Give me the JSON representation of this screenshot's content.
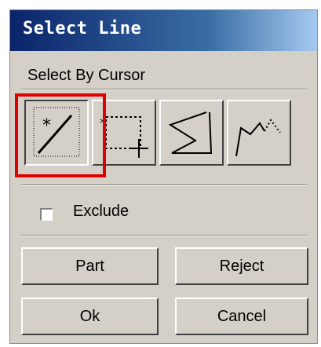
{
  "window": {
    "title": "Select Line"
  },
  "select_by": {
    "label": "Select By Cursor",
    "tools": [
      {
        "name": "single-line-select",
        "icon": "pick-line-icon",
        "pressed": true
      },
      {
        "name": "box-select",
        "icon": "box-select-icon",
        "pressed": false
      },
      {
        "name": "polygon-select",
        "icon": "polygon-select-icon",
        "pressed": false
      },
      {
        "name": "polyline-select",
        "icon": "polyline-select-icon",
        "pressed": false
      }
    ]
  },
  "exclude": {
    "label": "Exclude",
    "checked": false
  },
  "buttons": {
    "part": "Part",
    "reject": "Reject",
    "ok": "Ok",
    "cancel": "Cancel"
  },
  "colors": {
    "highlight": "#e00000",
    "dialog_bg": "#d4d0c8",
    "title_start": "#0a246a"
  }
}
